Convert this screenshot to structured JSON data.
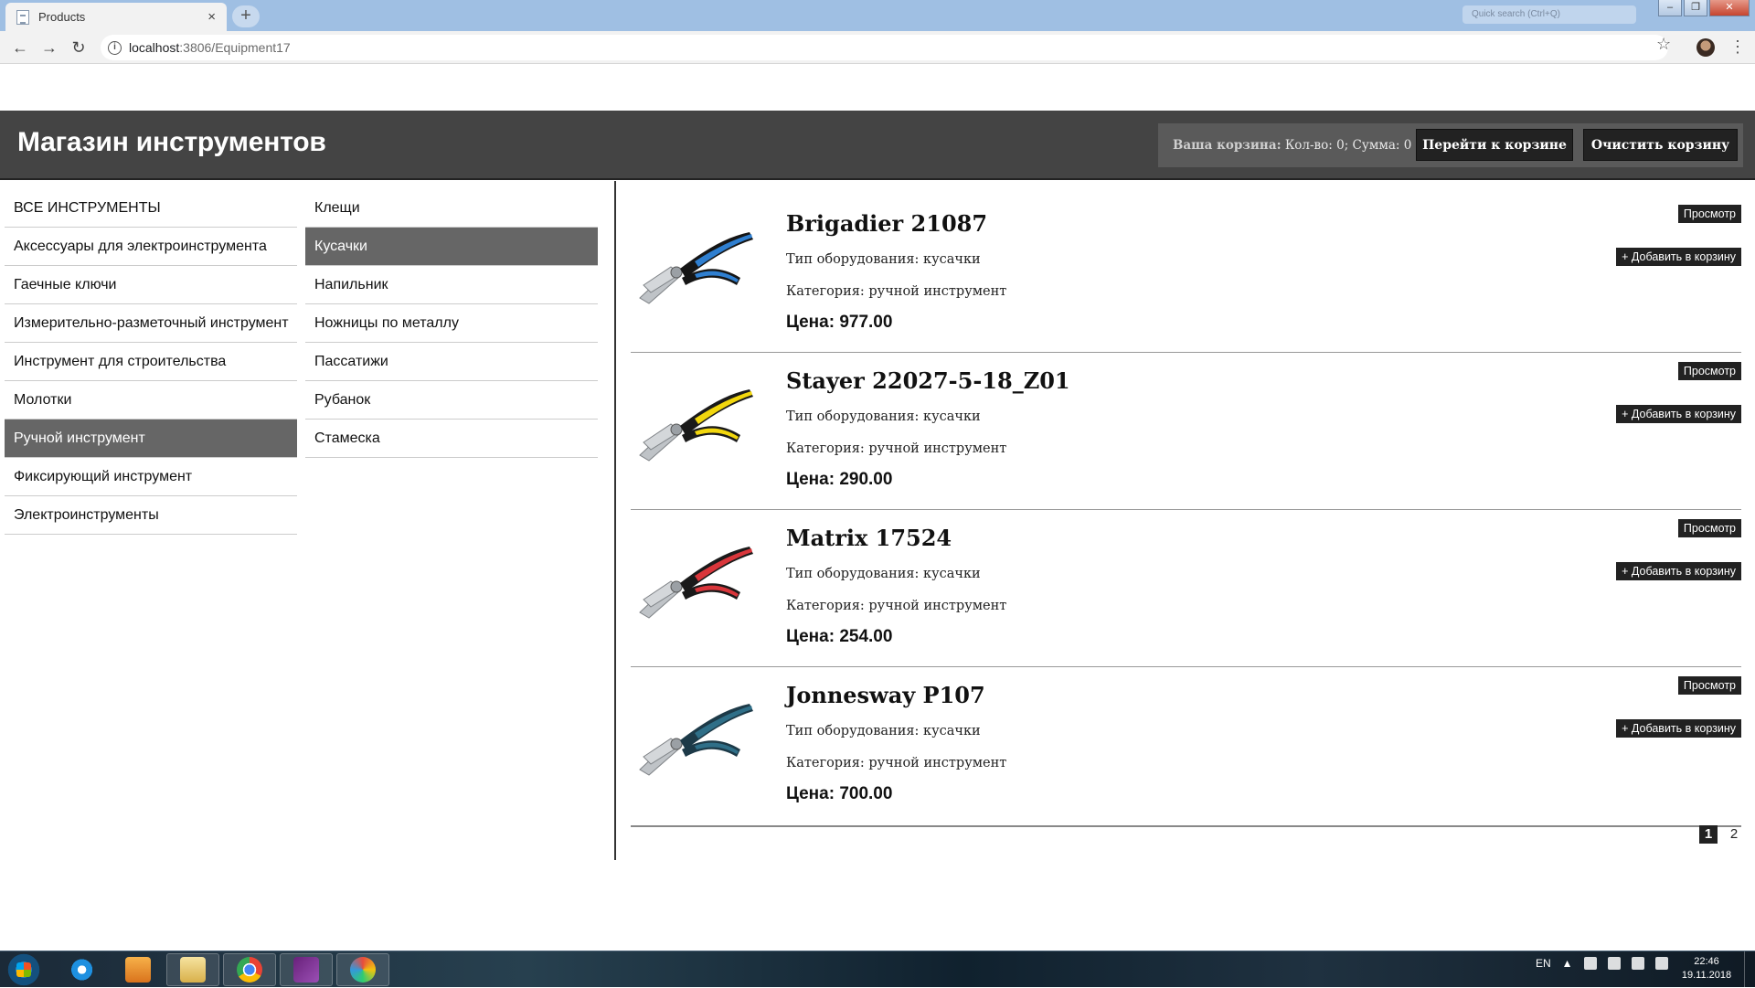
{
  "browser": {
    "tab_title": "Products",
    "tab_close": "×",
    "new_tab": "+",
    "url_host": "localhost",
    "url_path": ":3806/Equipment17",
    "back": "←",
    "forward": "→",
    "reload": "↻",
    "star": "☆",
    "menu": "⋮",
    "win_min": "–",
    "win_max": "❐",
    "win_close": "✕"
  },
  "header": {
    "brand": "Магазин инструментов",
    "cart_label": "Ваша корзина:",
    "cart_details": "Кол-во: 0; Сумма: 0",
    "goto_cart": "Перейти к корзине",
    "clear_cart": "Очистить корзину"
  },
  "categories": [
    {
      "label": "ВСЕ ИНСТРУМЕНТЫ",
      "active": false
    },
    {
      "label": "Аксессуары для электроинструмента",
      "active": false
    },
    {
      "label": "Гаечные ключи",
      "active": false
    },
    {
      "label": "Измерительно-разметочный инструмент",
      "active": false
    },
    {
      "label": "Инструмент для строительства",
      "active": false
    },
    {
      "label": "Молотки",
      "active": false
    },
    {
      "label": "Ручной инструмент",
      "active": true
    },
    {
      "label": "Фиксирующий инструмент",
      "active": false
    },
    {
      "label": "Электроинструменты",
      "active": false
    }
  ],
  "subcategories": [
    {
      "label": "Клещи",
      "active": false
    },
    {
      "label": "Кусачки",
      "active": true
    },
    {
      "label": "Напильник",
      "active": false
    },
    {
      "label": "Ножницы по металлу",
      "active": false
    },
    {
      "label": "Пассатижи",
      "active": false
    },
    {
      "label": "Рубанок",
      "active": false
    },
    {
      "label": "Стамеска",
      "active": false
    }
  ],
  "products": [
    {
      "name": "Brigadier 21087",
      "type": "Тип оборудования: кусачки",
      "category": "Категория: ручной инструмент",
      "price": "Цена: 977.00",
      "view": "Просмотр",
      "add": "+ Добавить в корзину",
      "handle_color": "#2f7fd0",
      "handle_dark": "#151515"
    },
    {
      "name": "Stayer 22027-5-18_Z01",
      "type": "Тип оборудования: кусачки",
      "category": "Категория: ручной инструмент",
      "price": "Цена: 290.00",
      "view": "Просмотр",
      "add": "+ Добавить в корзину",
      "handle_color": "#f2d70e",
      "handle_dark": "#1a1a1a"
    },
    {
      "name": "Matrix 17524",
      "type": "Тип оборудования: кусачки",
      "category": "Категория: ручной инструмент",
      "price": "Цена: 254.00",
      "view": "Просмотр",
      "add": "+ Добавить в корзину",
      "handle_color": "#d9363b",
      "handle_dark": "#1a1a1a"
    },
    {
      "name": "Jonnesway P107",
      "type": "Тип оборудования: кусачки",
      "category": "Категория: ручной инструмент",
      "price": "Цена: 700.00",
      "view": "Просмотр",
      "add": "+ Добавить в корзину",
      "handle_color": "#2f6f88",
      "handle_dark": "#1d3a48"
    }
  ],
  "pagination": [
    {
      "label": "1",
      "current": true
    },
    {
      "label": "2",
      "current": false
    }
  ],
  "taskbar": {
    "lang": "EN",
    "time": "22:46",
    "date": "19.11.2018",
    "search_placeholder": "Quick search (Ctrl+Q)"
  }
}
